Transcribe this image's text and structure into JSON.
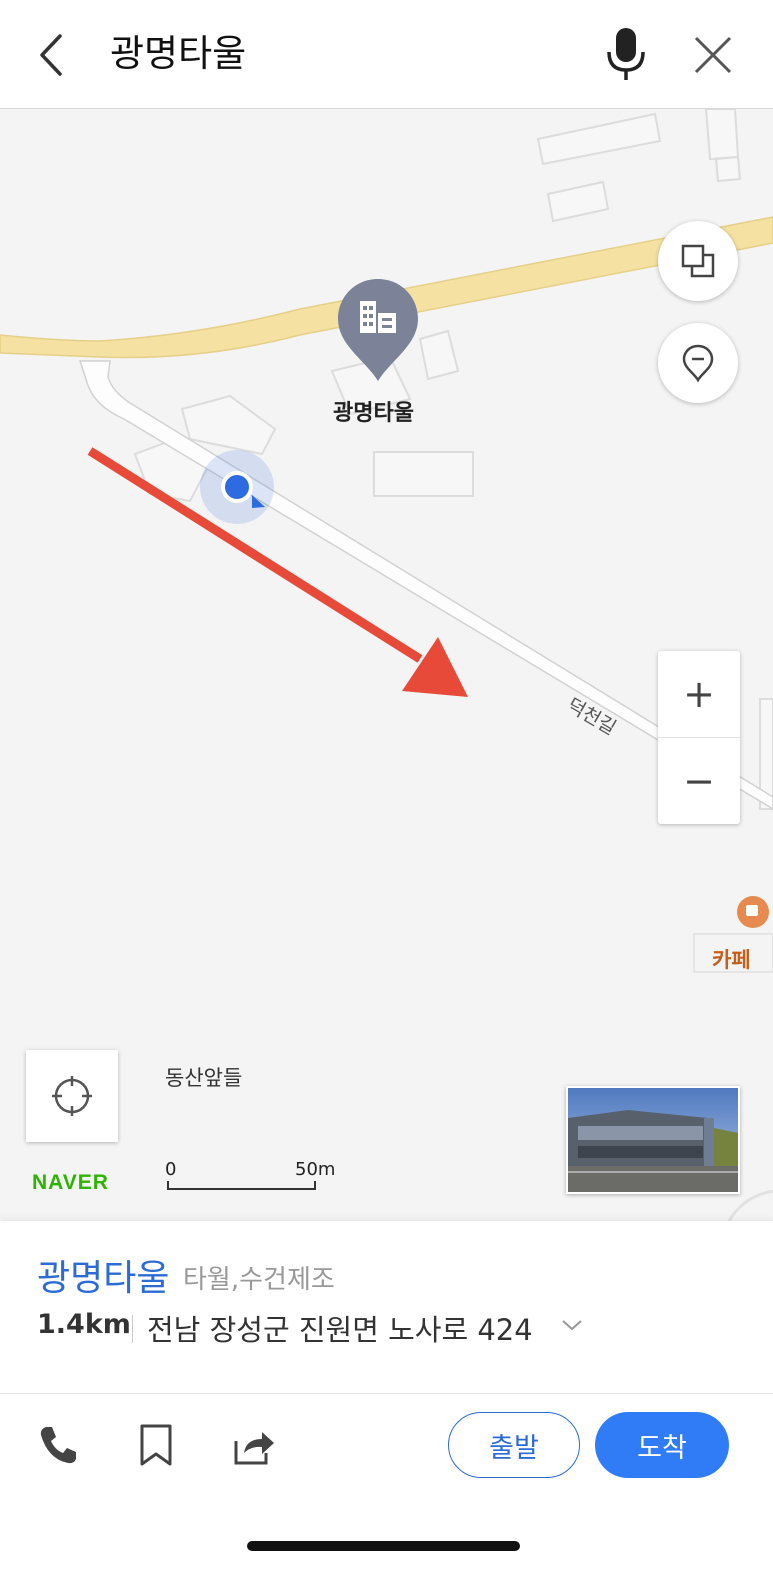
{
  "search": {
    "query": "광명타울"
  },
  "map": {
    "poi_label": "광명타울",
    "road_label": "덕천길",
    "area_label": "동산앞들",
    "cafe_label": "카페",
    "provider": "NAVER",
    "scale": {
      "start": "0",
      "end": "50m"
    },
    "zoom_in": "+",
    "zoom_out": "−"
  },
  "place": {
    "name": "광명타울",
    "category": "타월,수건제조",
    "distance": "1.4km",
    "address": "전남 장성군 진원면 노사로 424"
  },
  "actions": {
    "start_label": "출발",
    "arrive_label": "도착"
  },
  "colors": {
    "accent": "#2f7cf6",
    "arrow": "#e84a3a",
    "naver_green": "#2db400",
    "road_yellow": "#f5e2a2"
  }
}
